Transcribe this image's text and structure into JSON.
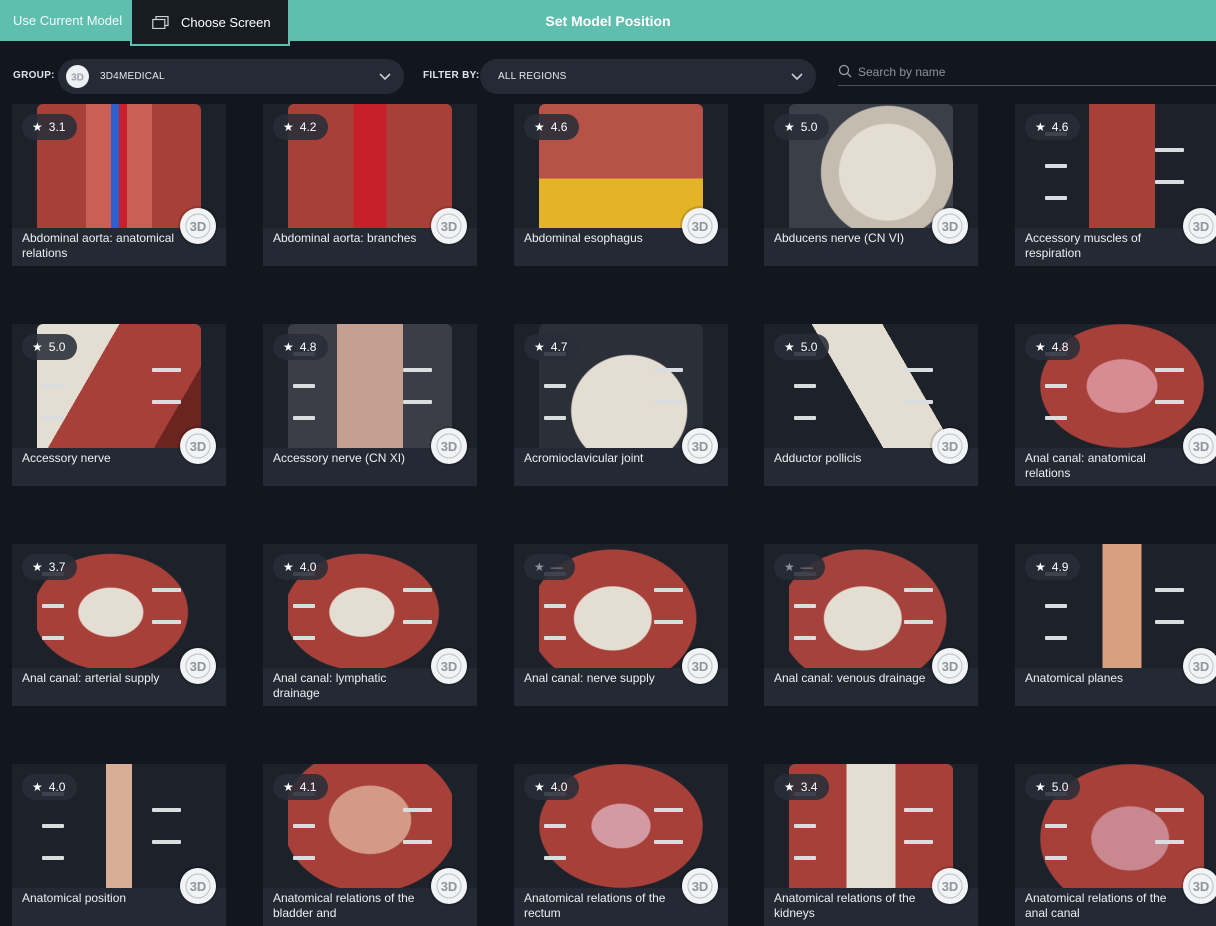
{
  "topbar": {
    "use_current_model": "Use Current Model",
    "choose_screen": "Choose Screen",
    "title": "Set Model Position"
  },
  "filters": {
    "group_label": "GROUP:",
    "group_value": "3D4MEDICAL",
    "filter_label": "FILTER BY:",
    "filter_value": "ALL REGIONS",
    "search_placeholder": "Search by name"
  },
  "colors": {
    "accent": "#5fbfae",
    "background": "#12161e",
    "card": "#242a33",
    "muscle": "#a8403a",
    "bone": "#e4ddd2",
    "artery": "#c8202a",
    "vein": "#2c5fd0",
    "skin": "#d9a080"
  },
  "cards": [
    {
      "title": "Abdominal aorta: anatomical relations",
      "rating": "3.1",
      "icon": "3d-badge-icon"
    },
    {
      "title": "Abdominal aorta: branches",
      "rating": "4.2",
      "icon": "3d-badge-icon"
    },
    {
      "title": "Abdominal esophagus",
      "rating": "4.6",
      "icon": "3d-badge-icon"
    },
    {
      "title": "Abducens nerve (CN VI)",
      "rating": "5.0",
      "icon": "3d-badge-icon"
    },
    {
      "title": "Accessory muscles of respiration",
      "rating": "4.6",
      "icon": "3d-badge-icon"
    },
    {
      "title": "Accessory nerve",
      "rating": "5.0",
      "icon": "3d-badge-icon"
    },
    {
      "title": "Accessory nerve (CN XI)",
      "rating": "4.8",
      "icon": "3d-badge-icon"
    },
    {
      "title": "Acromioclavicular joint",
      "rating": "4.7",
      "icon": "3d-badge-icon"
    },
    {
      "title": "Adductor pollicis",
      "rating": "5.0",
      "icon": "3d-badge-icon"
    },
    {
      "title": "Anal canal: anatomical relations",
      "rating": "4.8",
      "icon": "3d-badge-icon"
    },
    {
      "title": "Anal canal: arterial supply",
      "rating": "3.7",
      "icon": "3d-badge-icon"
    },
    {
      "title": "Anal canal: lymphatic drainage",
      "rating": "4.0",
      "icon": "3d-badge-icon"
    },
    {
      "title": "Anal canal: nerve supply",
      "rating": "—",
      "icon": "3d-badge-icon"
    },
    {
      "title": "Anal canal: venous drainage",
      "rating": "—",
      "icon": "3d-badge-icon"
    },
    {
      "title": "Anatomical planes",
      "rating": "4.9",
      "icon": "3d-badge-icon"
    },
    {
      "title": "Anatomical position",
      "rating": "4.0",
      "icon": "3d-badge-icon"
    },
    {
      "title": "Anatomical relations of the bladder and",
      "rating": "4.1",
      "icon": "3d-badge-icon"
    },
    {
      "title": "Anatomical relations of the rectum",
      "rating": "4.0",
      "icon": "3d-badge-icon"
    },
    {
      "title": "Anatomical relations of the kidneys",
      "rating": "3.4",
      "icon": "3d-badge-icon"
    },
    {
      "title": "Anatomical relations of the anal canal",
      "rating": "5.0",
      "icon": "3d-badge-icon"
    }
  ]
}
